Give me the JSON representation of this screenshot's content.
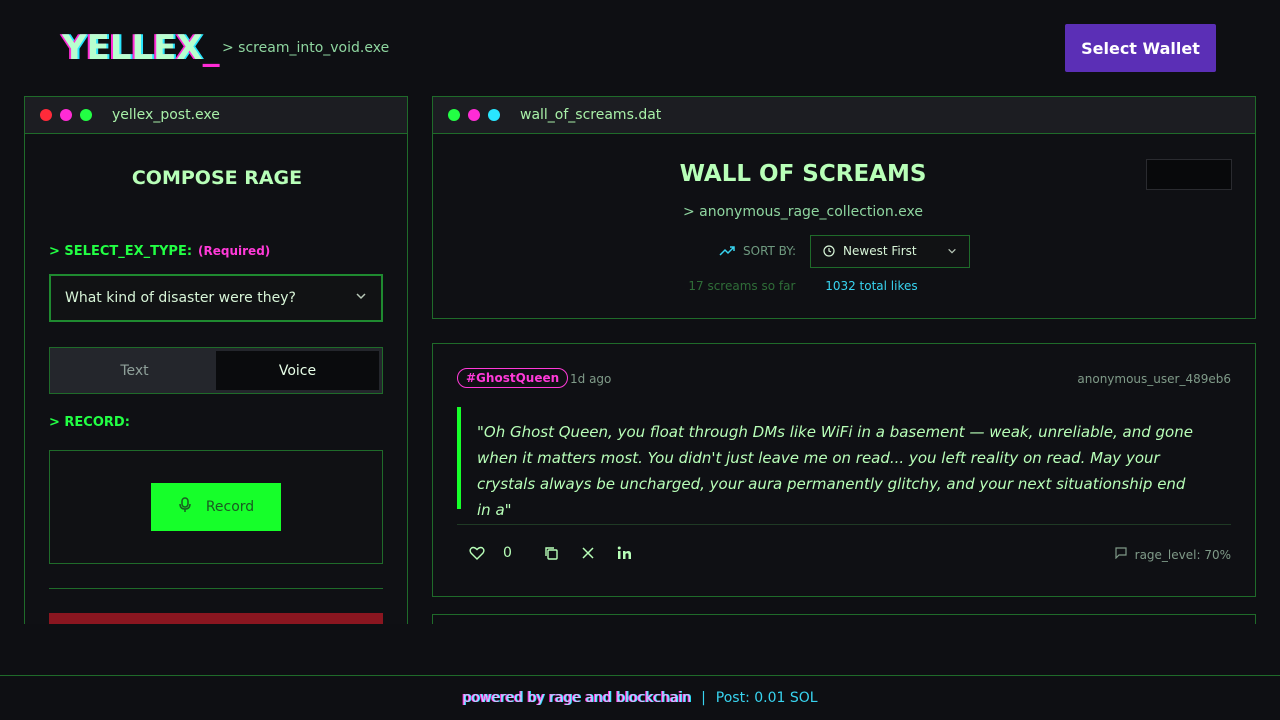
{
  "header": {
    "logo": "YELLEX",
    "logo_cursor": "_",
    "tagline": "> scream_into_void.exe",
    "wallet_button": "Select Wallet"
  },
  "compose_panel": {
    "window_title": "yellex_post.exe",
    "dots": [
      "#ff2a3a",
      "#ff2bd6",
      "#22ff44"
    ],
    "heading": "COMPOSE RAGE",
    "ex_type_label": "> SELECT_EX_TYPE:",
    "required_label": "(Required)",
    "ex_type_select": {
      "value": "What kind of disaster were they?",
      "icon": "chevron-down-icon"
    },
    "mode_toggle": {
      "options": [
        "Text",
        "Voice"
      ],
      "selected": "Voice"
    },
    "record_label": "> RECORD:",
    "record_button": {
      "label": "Record",
      "icon": "microphone-icon"
    }
  },
  "wall_panel": {
    "window_title": "wall_of_screams.dat",
    "dots": [
      "#22ff44",
      "#ff2bd6",
      "#29e6ff"
    ],
    "heading": "WALL OF SCREAMS",
    "subheading": "> anonymous_rage_collection.exe",
    "sort_label": "SORT BY:",
    "sort_value": "Newest First",
    "screams_count": "17 screams so far",
    "total_likes": "1032 total likes"
  },
  "posts": [
    {
      "hashtag": "#GhostQueen",
      "time": "1d ago",
      "user": "anonymous_user_489eb6",
      "text": "\"Oh Ghost Queen, you float through DMs like WiFi in a basement — weak, unreliable, and gone when it matters most. You didn't just leave me on read... you left reality on read. May your crystals always be uncharged, your aura permanently glitchy, and your next situationship end in a\"",
      "likes": "0",
      "rage_level": "rage_level: 70%"
    }
  ],
  "footer": {
    "powered": "powered by rage and blockchain",
    "separator": "|",
    "post_cost": "Post: 0.01 SOL"
  }
}
